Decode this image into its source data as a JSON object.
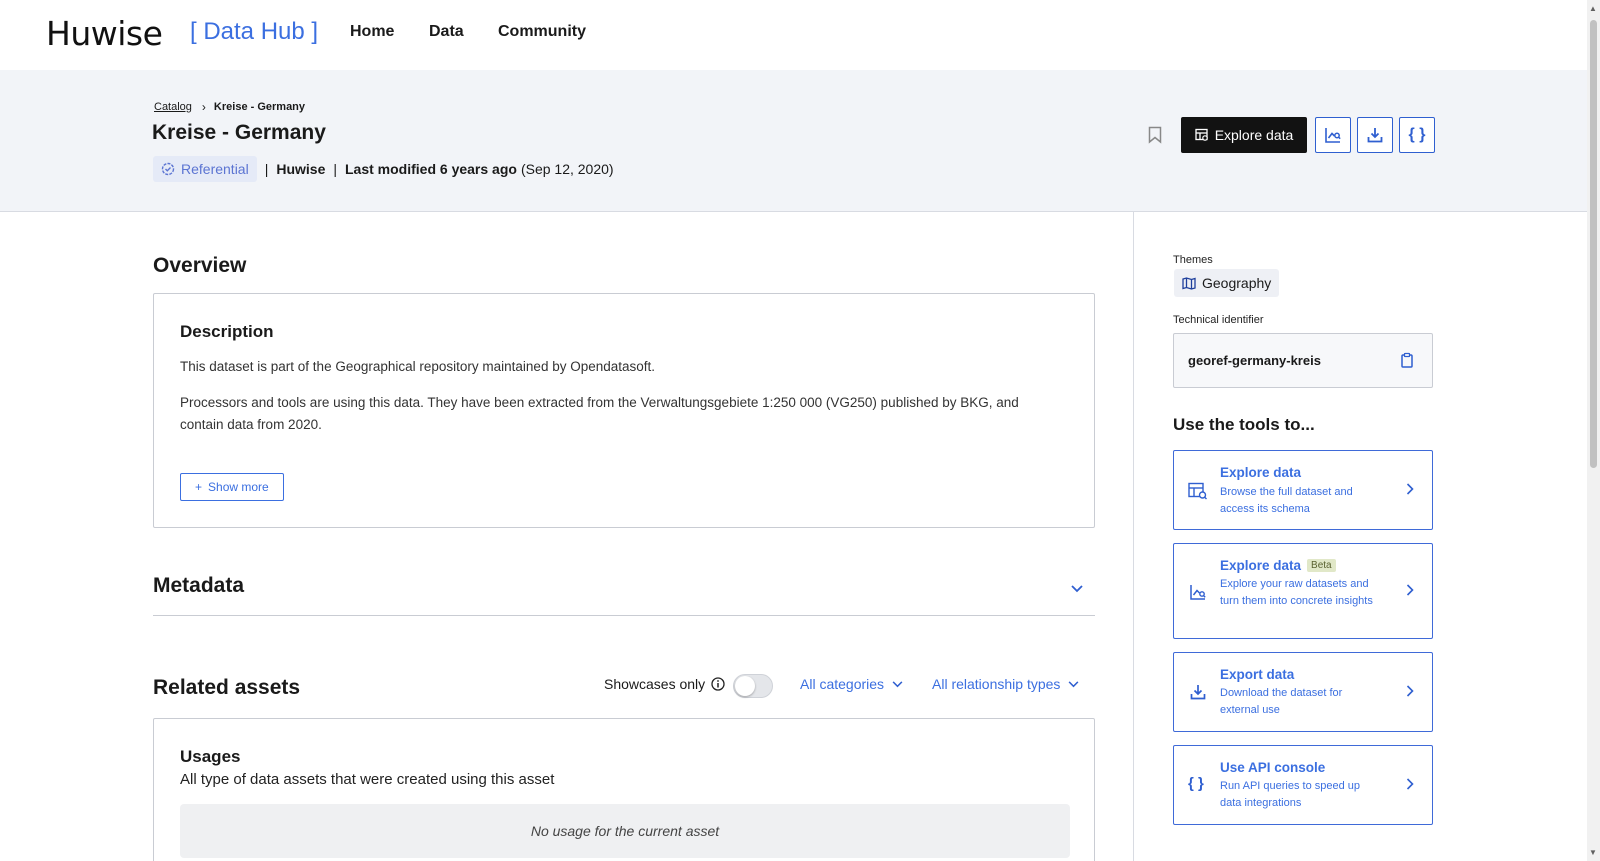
{
  "nav": {
    "logo": "Huwise",
    "hub": "[ Data Hub ]",
    "links": [
      "Home",
      "Data",
      "Community"
    ]
  },
  "header": {
    "breadcrumb_parent": "Catalog",
    "breadcrumb_current": "Kreise - Germany",
    "title": "Kreise - Germany",
    "badge": "Referential",
    "publisher": "Huwise",
    "modified_label": "Last modified 6 years ago",
    "modified_date": "(Sep 12, 2020)",
    "explore_button": "Explore data"
  },
  "overview": {
    "heading": "Overview",
    "description_title": "Description",
    "p1": "This dataset is part of the Geographical repository maintained by Opendatasoft.",
    "p2": "Processors and tools are using this data. They have been extracted from the Verwaltungsgebiete 1:250 000 (VG250) published by BKG, and contain data from 2020.",
    "show_more": "Show more"
  },
  "metadata": {
    "heading": "Metadata"
  },
  "related": {
    "heading": "Related assets",
    "showcases_label": "Showcases only",
    "categories": "All categories",
    "relationships": "All relationship types",
    "usages_title": "Usages",
    "usages_sub": "All type of data assets that were created using this asset",
    "empty": "No usage for the current asset"
  },
  "sidebar": {
    "themes_label": "Themes",
    "theme": "Geography",
    "tech_label": "Technical identifier",
    "tech_id": "georef-germany-kreis",
    "tools_heading": "Use the tools to...",
    "tools": [
      {
        "title": "Explore data",
        "desc": "Browse the full dataset and access its schema",
        "icon": "table-search-icon"
      },
      {
        "title": "Explore data",
        "badge": "Beta",
        "desc": "Explore your raw datasets and turn them into concrete insights",
        "icon": "chart-search-icon"
      },
      {
        "title": "Export data",
        "desc": "Download the dataset for external use",
        "icon": "download-icon"
      },
      {
        "title": "Use API console",
        "desc": "Run API queries to speed up data integrations",
        "icon": "braces-icon"
      }
    ]
  },
  "colors": {
    "accent": "#3b6fe0",
    "dark": "#121212",
    "band": "#f2f4f8"
  }
}
